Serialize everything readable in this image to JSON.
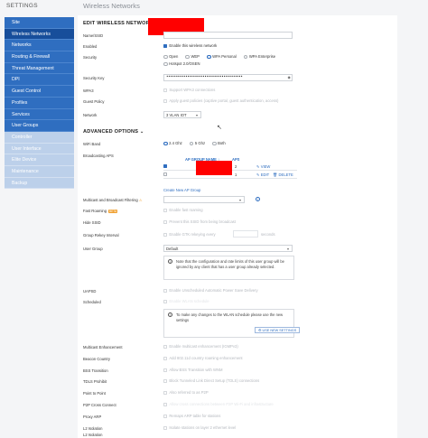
{
  "sidebar": {
    "title": "SETTINGS",
    "items": [
      {
        "label": "Site"
      },
      {
        "label": "Wireless Networks"
      },
      {
        "label": "Networks"
      },
      {
        "label": "Routing & Firewall"
      },
      {
        "label": "Threat Management"
      },
      {
        "label": "DPI"
      },
      {
        "label": "Guest Control"
      },
      {
        "label": "Profiles"
      },
      {
        "label": "Services"
      },
      {
        "label": "User Groups"
      },
      {
        "label": "Controller"
      },
      {
        "label": "User Interface"
      },
      {
        "label": "Elite Device"
      },
      {
        "label": "Maintenance"
      },
      {
        "label": "Backup"
      }
    ]
  },
  "page": {
    "title": "Wireless Networks"
  },
  "form": {
    "heading": "EDIT WIRELESS NETWORK",
    "name_label": "Name/SSID",
    "enabled_label": "Enabled",
    "enabled_text": "Enable this wireless network",
    "security_label": "Security",
    "security_options": [
      "Open",
      "WEP",
      "WPA Personal",
      "WPA Enterprise"
    ],
    "hotspot_text": "Hotspot 2.0/OSEN",
    "key_label": "Security Key",
    "key_value": "••••••••••••••••••••••••••••••••••••••••",
    "wpa3_label": "WPA3",
    "wpa3_text": "Support WPA3 connections",
    "guest_label": "Guest Policy",
    "guest_text": "Apply guest policies (captive portal, guest authentication, access)",
    "network_label": "Network",
    "network_value": "3 VLAN IOT"
  },
  "advanced": {
    "heading": "ADVANCED OPTIONS",
    "wifi_band_label": "WiFi Band",
    "bands": [
      "2.4 Ghz",
      "5 Ghz",
      "Both"
    ],
    "broadcast_label": "Broadcasting APS",
    "table_headers": [
      "AP GROUP NAME",
      "APS"
    ],
    "rows": [
      {
        "aps": "2",
        "actions": [
          "VIEW"
        ]
      },
      {
        "aps": "1",
        "actions": [
          "EDIT",
          "DELETE"
        ]
      }
    ],
    "create_group": "Create New AP Group",
    "mcast_label": "Multicast and Broadcast Filtering",
    "fast_roaming_label": "Fast Roaming",
    "fast_roaming_badge": "BETA",
    "fast_roaming_text": "Enable fast roaming",
    "hide_ssid_label": "Hide SSID",
    "hide_ssid_text": "Prevent this SSID from being broadcast",
    "rekey_label": "Group Rekey Interval",
    "rekey_text": "Enable GTK rekeying every",
    "rekey_unit": "seconds",
    "user_group_label": "User Group",
    "user_group_value": "Default",
    "user_group_note": "Note that the configuration and rate limits of this user group will be ignored by any client that has a user group already selected.",
    "uapsd_label": "UAPSD",
    "uapsd_text": "Enable Unscheduled Automatic Power Save Delivery",
    "scheduled_label": "Scheduled",
    "scheduled_text": "Enable WLAN schedule",
    "schedule_note": "To make any changes to the WLAN schedule please use the new settings",
    "use_new_settings": "USE NEW SETTINGS",
    "mcast_enh_label": "Multicast Enhancement",
    "mcast_enh_text": "Enable multicast enhancement (IGMPv3)",
    "beacon_label": "Beacon Country",
    "beacon_text": "Add 802.11d country roaming enhancement",
    "bss_label": "BSS Transition",
    "bss_text": "Allow BSS Transition with WNM",
    "tdls_label": "TDLS Prohibit",
    "tdls_text": "Block Tunneled Link Direct Setup (TDLS) connections",
    "p2p_label": "Point to Point",
    "p2p_text": "Also referred to as P2P",
    "p2p_cross_label": "P2P Cross Connect",
    "p2p_cross_text": "Allow cross connections between P2P Wi-Fi and infrastructure",
    "proxy_arp_label": "Proxy ARP",
    "proxy_arp_text": "Remaps ARP table for stations",
    "l2_label": "L2 Isolation",
    "l2_text": "Isolate stations on layer 2 ethernet level",
    "l2_label2": "L2 Isolation"
  },
  "colors": {
    "accent": "#2f6ec0",
    "sidebar_active": "#174e9b",
    "redaction": "#ff0000"
  }
}
